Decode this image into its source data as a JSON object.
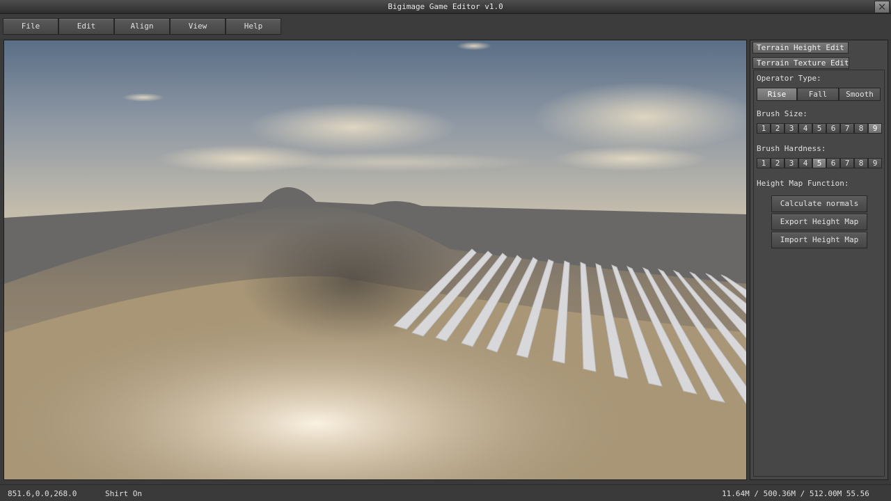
{
  "window": {
    "title": "Bigimage Game Editor v1.0",
    "close_label": "✕"
  },
  "menu": [
    {
      "label": "File"
    },
    {
      "label": "Edit"
    },
    {
      "label": "Align"
    },
    {
      "label": "View"
    },
    {
      "label": "Help"
    }
  ],
  "panel": {
    "tabs": [
      {
        "label": "Terrain Height Edit",
        "active": true
      },
      {
        "label": "Terrain Texture Edit",
        "active": false
      }
    ],
    "operator_label": "Operator Type:",
    "operators": [
      {
        "label": "Rise",
        "selected": true
      },
      {
        "label": "Fall",
        "selected": false
      },
      {
        "label": "Smooth",
        "selected": false
      }
    ],
    "brush_size_label": "Brush Size:",
    "brush_size": {
      "options": [
        "1",
        "2",
        "3",
        "4",
        "5",
        "6",
        "7",
        "8",
        "9"
      ],
      "selected": "9"
    },
    "brush_hardness_label": "Brush Hardness:",
    "brush_hardness": {
      "options": [
        "1",
        "2",
        "3",
        "4",
        "5",
        "6",
        "7",
        "8",
        "9"
      ],
      "selected": "5"
    },
    "heightmap_label": "Height Map Function:",
    "functions": [
      {
        "label": "Calculate normals"
      },
      {
        "label": "Export Height Map"
      },
      {
        "label": "Import Height Map"
      }
    ]
  },
  "status": {
    "coordinates": "851.6,0.0,268.0",
    "mode": "Shirt On",
    "memory": "11.64M / 500.36M / 512.00M 55.56"
  },
  "colors": {
    "accent_selected": "#8a8a8a",
    "background": "#3a3a3a"
  }
}
